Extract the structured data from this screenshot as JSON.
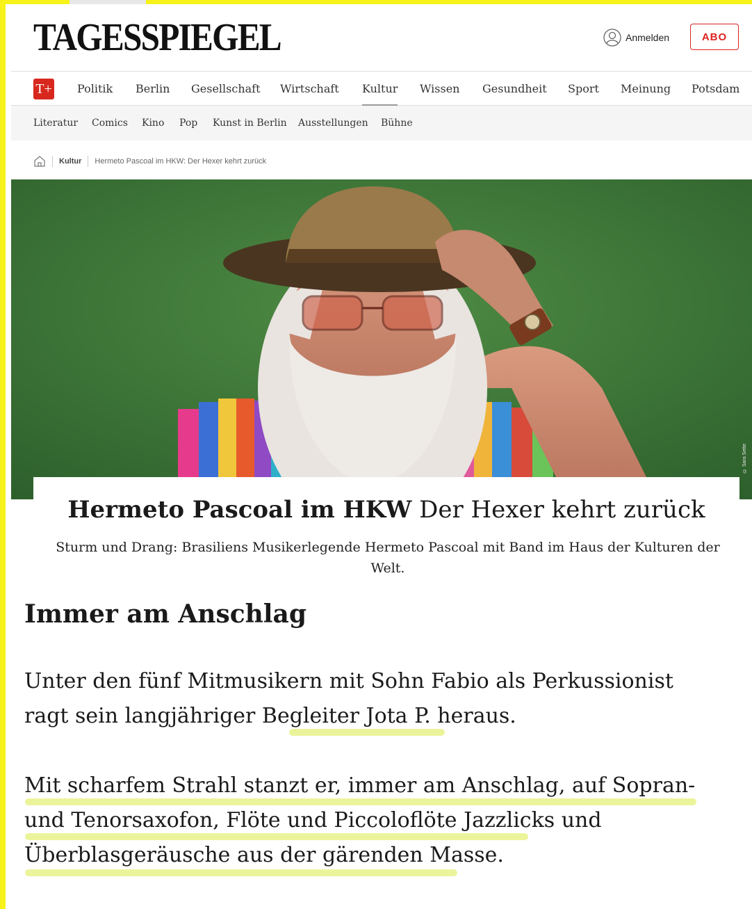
{
  "header": {
    "logo": "TAGESSPIEGEL",
    "login_label": "Anmelden",
    "abo_label": "ABO",
    "tplus_label": "T+"
  },
  "nav": {
    "items": [
      "Politik",
      "Berlin",
      "Gesellschaft",
      "Wirtschaft",
      "Kultur",
      "Wissen",
      "Gesundheit",
      "Sport",
      "Meinung",
      "Potsdam"
    ],
    "active": "Kultur"
  },
  "subnav": {
    "items": [
      "Literatur",
      "Comics",
      "Kino",
      "Pop",
      "Kunst in Berlin",
      "Ausstellungen",
      "Bühne"
    ]
  },
  "breadcrumb": {
    "section": "Kultur",
    "current": "Hermeto Pascoal im HKW: Der Hexer kehrt zurück"
  },
  "hero": {
    "credit": "© Sara Sette"
  },
  "article": {
    "kicker": "Hermeto Pascoal im HKW",
    "headline": "Der Hexer kehrt zurück",
    "teaser": "Sturm und Drang: Brasiliens Musikerlegende Hermeto Pascoal mit Band im Haus der Kulturen der Welt.",
    "section_title": "Immer am Anschlag",
    "paragraph1": "Unter den fünf Mitmusikern mit Sohn Fabio als Perkussionist ragt sein langjähriger Begleiter Jota P. heraus.",
    "paragraph2": "Mit scharfem Strahl stanzt er, immer am Anschlag, auf Sopran- und Tenorsaxofon, Flöte und Piccoloflöte Jazzlicks und Überblasgeräusche aus der gärenden Masse."
  },
  "colors": {
    "brand_red": "#d8281e",
    "highlight": "#e6f07a",
    "frame": "#f6f21a",
    "hero_bg": "#3f7a3a"
  }
}
